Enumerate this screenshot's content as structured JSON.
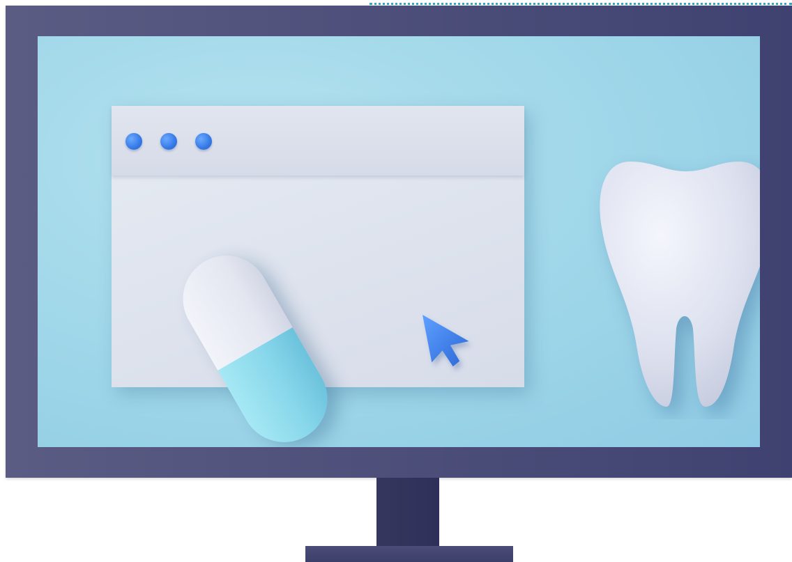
{
  "scene": {
    "description_label": "",
    "colors": {
      "monitor_frame": "#4d4f7a",
      "screen_background": "#a3d9ea",
      "browser_window": "#dde2ed",
      "window_dots": "#3579e6",
      "cursor": "#3a7fe8",
      "pill_white_half": "#e8ebf3",
      "pill_blue_half": "#86d6ea",
      "tooth": "#dfe3f0",
      "dotted_accent": "#2fa7c9"
    },
    "icons": {
      "cursor": "cursor-arrow-icon",
      "pill": "pill-icon",
      "tooth": "tooth-icon"
    }
  }
}
